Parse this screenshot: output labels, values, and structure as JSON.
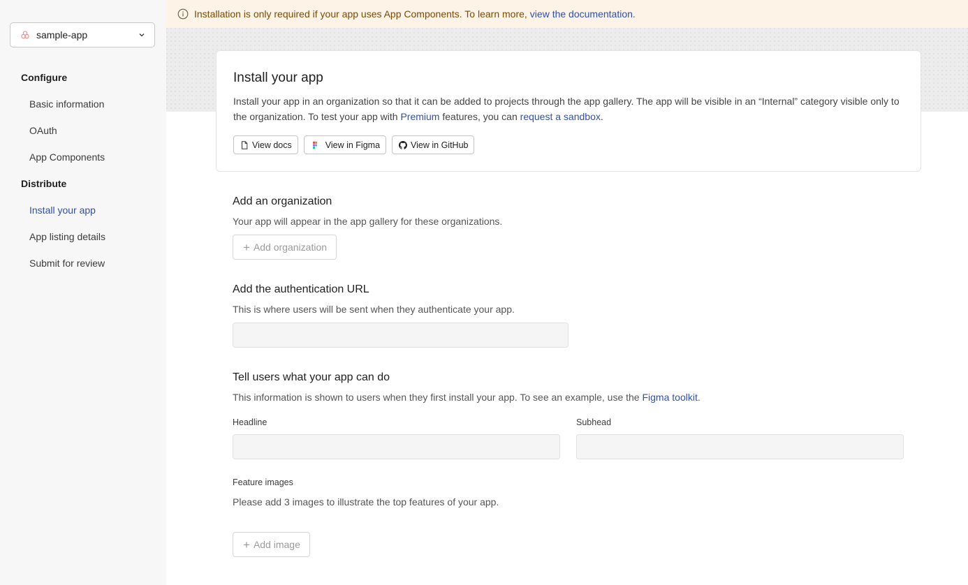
{
  "sidebar": {
    "app_name": "sample-app",
    "sections": [
      {
        "title": "Configure",
        "items": [
          "Basic information",
          "OAuth",
          "App Components"
        ]
      },
      {
        "title": "Distribute",
        "items": [
          "Install your app",
          "App listing details",
          "Submit for review"
        ]
      }
    ],
    "active_item": "Install your app"
  },
  "banner": {
    "text": "Installation is only required if your app uses App Components. To learn more,",
    "link": "view the documentation",
    "suffix": "."
  },
  "card": {
    "title": "Install your app",
    "desc_part1": "Install your app in an organization so that it can be added to projects through the app gallery. The app will be visible in an “Internal” category visible only to the organization. To test your app with",
    "desc_link1": "Premium",
    "desc_part2": "features, you can",
    "desc_link2": "request a sandbox",
    "desc_part3": ".",
    "buttons": {
      "docs": "View docs",
      "figma": "View in Figma",
      "github": "View in GitHub"
    }
  },
  "org_section": {
    "title": "Add an organization",
    "desc": "Your app will appear in the app gallery for these organizations.",
    "button": "Add organization"
  },
  "auth_section": {
    "title": "Add the authentication URL",
    "desc": "This is where users will be sent when they authenticate your app.",
    "value": ""
  },
  "tell_section": {
    "title": "Tell users what your app can do",
    "desc_part1": "This information is shown to users when they first install your app. To see an example, use the",
    "desc_link": "Figma toolkit",
    "desc_part2": ".",
    "headline_label": "Headline",
    "subhead_label": "Subhead",
    "feature_images_label": "Feature images",
    "feature_images_desc": "Please add 3 images to illustrate the top features of your app.",
    "add_image_button": "Add image"
  },
  "colors": {
    "link": "#2f4fb0",
    "banner_bg": "#fdf3e7",
    "banner_text": "#7a4a05",
    "sidebar_bg": "#f7f7f7"
  }
}
